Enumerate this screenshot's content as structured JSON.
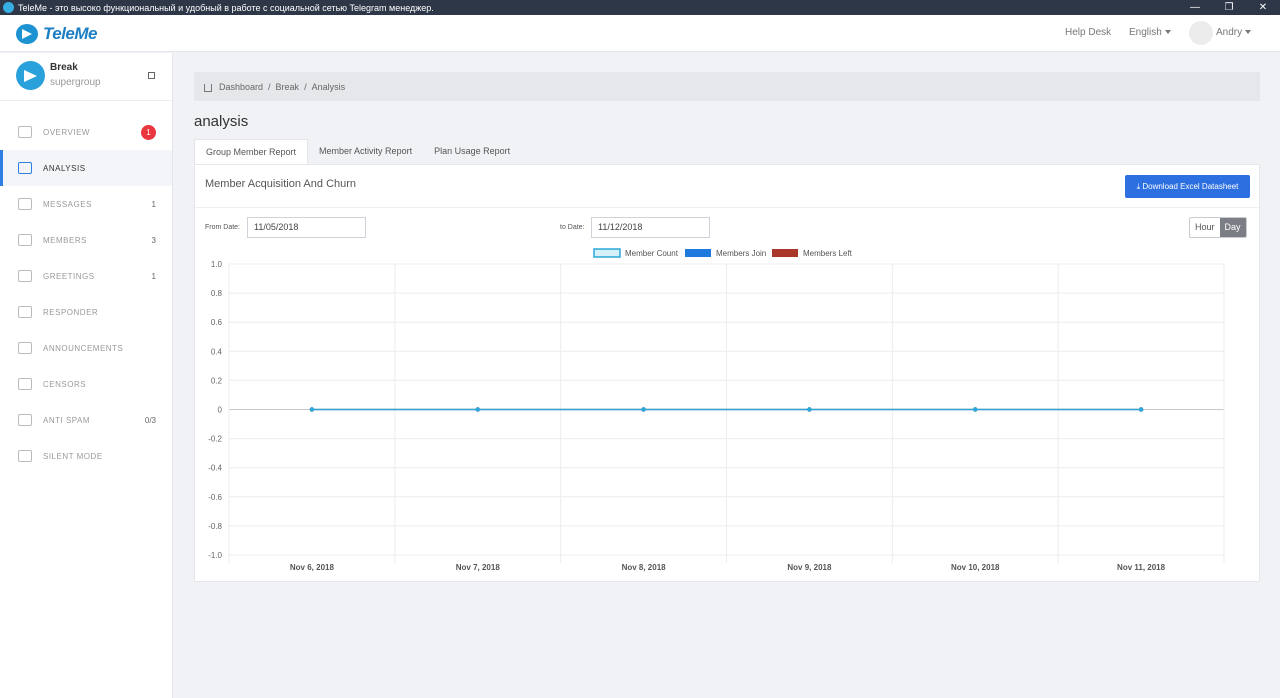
{
  "window": {
    "title": "TeleMe - это высоко функциональный и удобный в работе с социальной сетью Telegram менеджер.",
    "controls": [
      "—",
      "❐",
      "✕"
    ]
  },
  "header": {
    "logo_text": "TeleMe",
    "help": "Help Desk",
    "language": "English",
    "user": "Andry"
  },
  "group": {
    "name": "Break",
    "type": "supergroup"
  },
  "nav": [
    {
      "label": "OVERVIEW",
      "icon": "home-icon",
      "badge": "1"
    },
    {
      "label": "ANALYSIS",
      "icon": "chart-icon",
      "active": true
    },
    {
      "label": "MESSAGES",
      "icon": "chat-icon",
      "count": "1"
    },
    {
      "label": "MEMBERS",
      "icon": "users-icon",
      "count": "3"
    },
    {
      "label": "GREETINGS",
      "icon": "thumbs-up-icon",
      "count": "1"
    },
    {
      "label": "RESPONDER",
      "icon": "responder-icon"
    },
    {
      "label": "ANNOUNCEMENTS",
      "icon": "megaphone-icon"
    },
    {
      "label": "CENSORS",
      "icon": "scissors-icon"
    },
    {
      "label": "ANTI SPAM",
      "icon": "robot-icon",
      "count": "0/3"
    },
    {
      "label": "SILENT MODE",
      "icon": "mute-icon"
    }
  ],
  "breadcrumb": [
    "Dashboard",
    "Break",
    "Analysis"
  ],
  "page_title": "analysis",
  "tabs": [
    "Group Member Report",
    "Member Activity Report",
    "Plan Usage Report"
  ],
  "panel": {
    "title": "Member Acquisition And Churn",
    "download_label": "⤓ Download Excel Datasheet",
    "from_label": "From Date:",
    "from_value": "11/05/2018",
    "to_label": "to Date:",
    "to_value": "11/12/2018",
    "toggle": [
      "Hour",
      "Day"
    ]
  },
  "colors": {
    "member_count": "#2aa8d8",
    "members_join": "#1f7ae0",
    "members_left": "#a9372a",
    "accent": "#2c6fe0"
  },
  "chart_data": {
    "type": "line",
    "categories": [
      "Nov 6, 2018",
      "Nov 7, 2018",
      "Nov 8, 2018",
      "Nov 9, 2018",
      "Nov 10, 2018",
      "Nov 11, 2018"
    ],
    "series": [
      {
        "name": "Member Count",
        "values": [
          0,
          0,
          0,
          0,
          0,
          0
        ]
      },
      {
        "name": "Members Join",
        "values": [
          0,
          0,
          0,
          0,
          0,
          0
        ]
      },
      {
        "name": "Members Left",
        "values": [
          0,
          0,
          0,
          0,
          0,
          0
        ]
      }
    ],
    "ylim": [
      -1.0,
      1.0
    ],
    "yticks": [
      "1.0",
      "0.8",
      "0.6",
      "0.4",
      "0.2",
      "0",
      "-0.2",
      "-0.4",
      "-0.6",
      "-0.8",
      "-1.0"
    ],
    "grid": true,
    "legend": "top"
  }
}
